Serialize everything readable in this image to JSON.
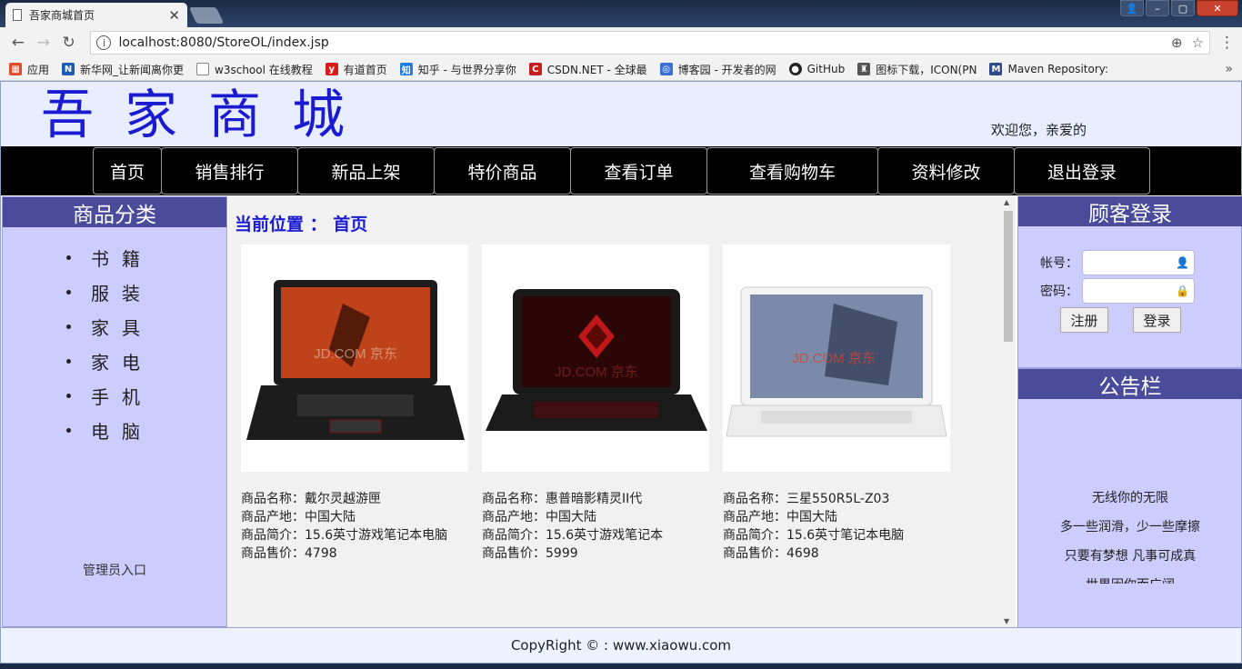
{
  "browser": {
    "tab_title": "吾家商城首页",
    "url": "localhost:8080/StoreOL/index.jsp",
    "bookmarks": [
      {
        "label": "应用",
        "color": "#e04b2b"
      },
      {
        "label": "新华网_让新闻离你更",
        "color": "#1e5bb5"
      },
      {
        "label": "w3school 在线教程",
        "color": "#888888"
      },
      {
        "label": "有道首页",
        "color": "#d91a1a"
      },
      {
        "label": "知乎 - 与世界分享你",
        "color": "#1e7be0"
      },
      {
        "label": "CSDN.NET - 全球最",
        "color": "#c81e1e"
      },
      {
        "label": "博客园 - 开发者的网",
        "color": "#3b6fd1"
      },
      {
        "label": "GitHub",
        "color": "#222222"
      },
      {
        "label": "图标下载，ICON(PN",
        "color": "#555555"
      },
      {
        "label": "Maven Repository:",
        "color": "#2a4a8a"
      }
    ]
  },
  "site": {
    "logo": "吾家商城",
    "welcome": "欢迎您，亲爱的"
  },
  "nav": [
    "首页",
    "销售排行",
    "新品上架",
    "特价商品",
    "查看订单",
    "查看购物车",
    "资料修改",
    "退出登录"
  ],
  "left": {
    "title": "商品分类",
    "categories": [
      "书籍",
      "服装",
      "家具",
      "家电",
      "手机",
      "电脑"
    ],
    "admin": "管理员入口"
  },
  "content": {
    "breadcrumb": "当前位置 ： 首页",
    "products": [
      {
        "name": "商品名称：戴尔灵越游匣",
        "origin": "商品产地：中国大陆",
        "desc": "商品简介：15.6英寸游戏笔记本电脑",
        "price": "商品售价：4798",
        "screen_color": "#c0421a",
        "body_color": "#1c1c1c",
        "watermark": "JD.COM 京东"
      },
      {
        "name": "商品名称：惠普暗影精灵II代",
        "origin": "商品产地：中国大陆",
        "desc": "商品简介：15.6英寸游戏笔记本",
        "price": "商品售价：5999",
        "screen_color": "#2a0606",
        "body_color": "#1a1a1a",
        "watermark": "JD.COM 京东"
      },
      {
        "name": "商品名称：三星550R5L-Z03",
        "origin": "商品产地：中国大陆",
        "desc": "商品简介：15.6英寸笔记本电脑",
        "price": "商品售价：4698",
        "screen_color": "#7a8aa8",
        "body_color": "#f4f4f4",
        "watermark": "JD.COM 京东"
      }
    ]
  },
  "login": {
    "title": "顾客登录",
    "account_label": "帐号：",
    "password_label": "密码：",
    "register": "注册",
    "login": "登录"
  },
  "notice": {
    "title": "公告栏",
    "lines": [
      "无线你的无限",
      "多一些润滑，少一些摩擦",
      "只要有梦想  凡事可成真",
      "世界因你而广阔"
    ]
  },
  "footer": "CopyRight © : www.xiaowu.com"
}
